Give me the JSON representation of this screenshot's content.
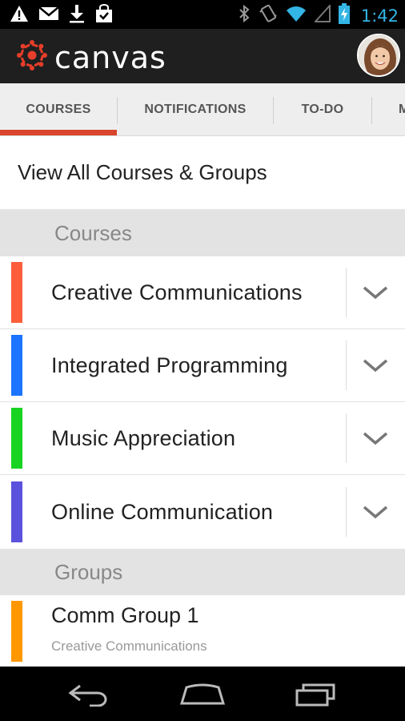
{
  "status_bar": {
    "time": "1:42",
    "time_color": "#33b5e5",
    "left_icons": [
      "warning-icon",
      "gmail-icon",
      "download-icon",
      "shopping-bag-icon"
    ],
    "right_icons": [
      "bluetooth-icon",
      "vibrate-icon",
      "wifi-icon",
      "signal-icon",
      "battery-charging-icon"
    ]
  },
  "app_bar": {
    "logo_text": "canvas",
    "logo_color": "#e63e2a",
    "background": "#1f1f1f"
  },
  "tabs": [
    {
      "label": "COURSES",
      "active": true
    },
    {
      "label": "NOTIFICATIONS",
      "active": false
    },
    {
      "label": "TO-DO",
      "active": false
    },
    {
      "label": "M",
      "active": false
    }
  ],
  "tab_indicator_color": "#d9452d",
  "view_all_label": "View All Courses & Groups",
  "courses_header": "Courses",
  "courses": [
    {
      "name": "Creative Communications",
      "color": "#fc5e3c"
    },
    {
      "name": "Integrated Programming",
      "color": "#1c74ff"
    },
    {
      "name": "Music Appreciation",
      "color": "#18d420"
    },
    {
      "name": "Online Communication",
      "color": "#5a52dd"
    }
  ],
  "groups_header": "Groups",
  "groups": [
    {
      "name": "Comm Group 1",
      "subtitle": "Creative Communications",
      "color": "#ff9800"
    }
  ],
  "nav_bar": {
    "buttons": [
      "back-icon",
      "home-icon",
      "recent-apps-icon"
    ]
  }
}
